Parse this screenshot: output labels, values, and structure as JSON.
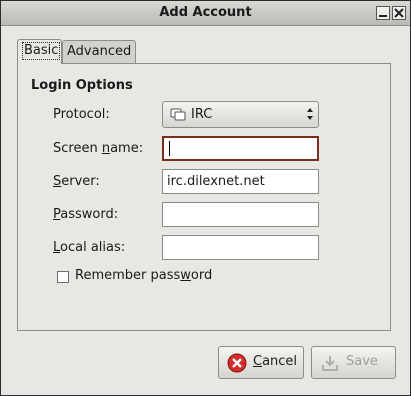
{
  "window": {
    "title": "Add Account"
  },
  "tabs": [
    {
      "label": "Basic",
      "active": true
    },
    {
      "label": "Advanced",
      "active": false
    }
  ],
  "login_options": {
    "title": "Login Options",
    "protocol": {
      "label": "Protocol:",
      "value": "IRC",
      "icon": "irc-protocol-icon"
    },
    "screen_name": {
      "label": "Screen name:",
      "value": ""
    },
    "server": {
      "label": "Server:",
      "value": "irc.dilexnet.net"
    },
    "password": {
      "label": "Password:",
      "value": ""
    },
    "local_alias": {
      "label": "Local alias:",
      "value": ""
    },
    "remember_password": {
      "label": "Remember password",
      "checked": false
    }
  },
  "buttons": {
    "cancel": {
      "label": "Cancel",
      "icon": "cancel-icon",
      "enabled": true
    },
    "save": {
      "label": "Save",
      "icon": "save-icon",
      "enabled": false
    }
  }
}
